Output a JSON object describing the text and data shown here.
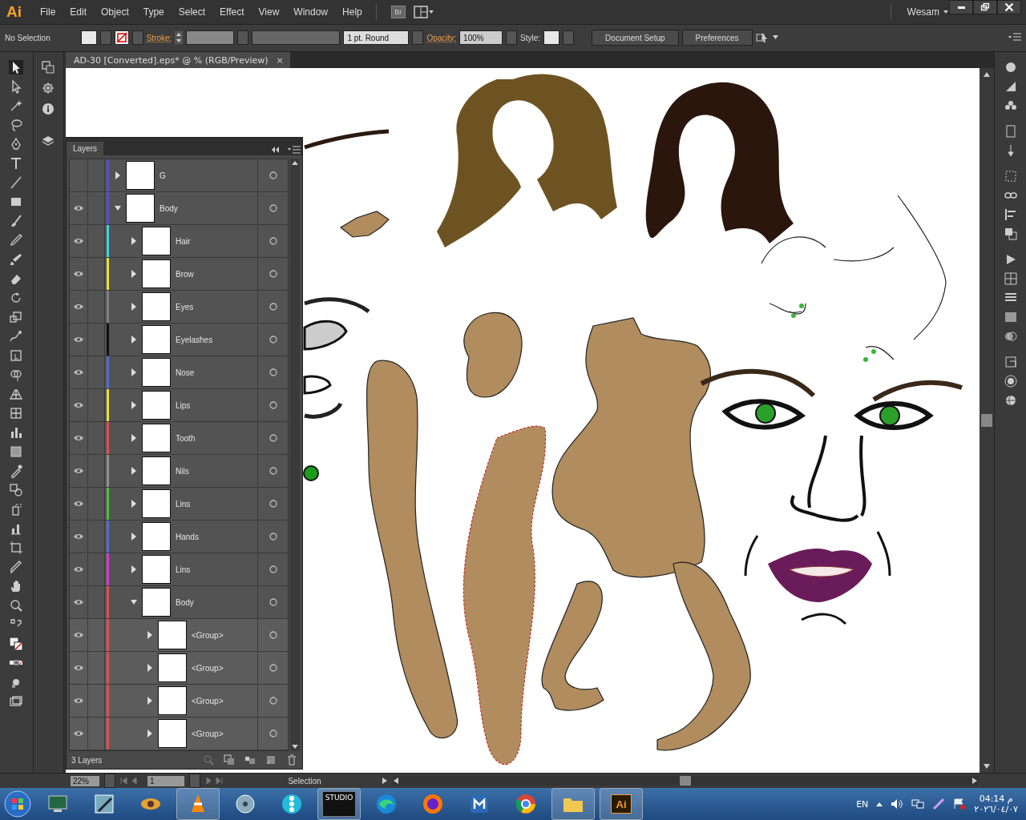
{
  "app_logo": "Ai",
  "menu": [
    "File",
    "Edit",
    "Object",
    "Type",
    "Select",
    "Effect",
    "View",
    "Window",
    "Help"
  ],
  "bridge_button": "Br",
  "user": "Wesam",
  "control_bar": {
    "selection": "No Selection",
    "stroke_label": "Stroke:",
    "brush": "1 pt. Round",
    "opacity_label": "Opacity:",
    "opacity": "100%",
    "style_label": "Style:",
    "buttons": [
      "Document Setup",
      "Preferences"
    ]
  },
  "document_tab": {
    "title": "AD-30 [Converted].eps* @ % (RGB/Preview)",
    "close": "×"
  },
  "layers_panel": {
    "title": "Layers",
    "footer": "3 Layers",
    "layers": [
      {
        "name": "G",
        "visible": false,
        "expanded": false,
        "color": "#5a50c8"
      },
      {
        "name": "Body",
        "visible": true,
        "expanded": true,
        "color": "#5a50c8",
        "children": [
          {
            "name": "Hair",
            "visible": true,
            "expanded": false,
            "color": "#40d0e0"
          },
          {
            "name": "Brow",
            "visible": true,
            "expanded": false,
            "color": "#e8e040"
          },
          {
            "name": "Eyes",
            "visible": true,
            "expanded": false,
            "color": "#808080"
          },
          {
            "name": "Eyelashes",
            "visible": true,
            "expanded": false,
            "color": "#101010"
          },
          {
            "name": "Nose",
            "visible": true,
            "expanded": false,
            "color": "#5070d0"
          },
          {
            "name": "Lips",
            "visible": true,
            "expanded": false,
            "color": "#e8e040"
          },
          {
            "name": "Tooth",
            "visible": true,
            "expanded": false,
            "color": "#e05050"
          },
          {
            "name": "Nils",
            "visible": true,
            "expanded": false,
            "color": "#909090"
          },
          {
            "name": "Lins",
            "visible": true,
            "expanded": false,
            "color": "#50c040"
          },
          {
            "name": "Hands",
            "visible": true,
            "expanded": false,
            "color": "#5070d0"
          },
          {
            "name": "Lins",
            "visible": true,
            "expanded": false,
            "color": "#d040d0"
          },
          {
            "name": "Body",
            "visible": true,
            "expanded": true,
            "color": "#e05050",
            "children": [
              {
                "name": "<Group>",
                "visible": true,
                "expanded": false,
                "color": "#e05050"
              },
              {
                "name": "<Group>",
                "visible": true,
                "expanded": false,
                "color": "#e05050"
              },
              {
                "name": "<Group>",
                "visible": true,
                "expanded": false,
                "color": "#e05050"
              },
              {
                "name": "<Group>",
                "visible": true,
                "expanded": false,
                "color": "#e05050"
              }
            ]
          }
        ]
      }
    ]
  },
  "status_bar": {
    "zoom": "22%",
    "artboard": "1",
    "tool": "Selection"
  },
  "taskbar": {
    "studio_label": "STUDIO",
    "ai_label": "Ai",
    "language": "EN",
    "time": "م 04:14",
    "date": "٢٠٢٦/٠٤/٠٧"
  }
}
